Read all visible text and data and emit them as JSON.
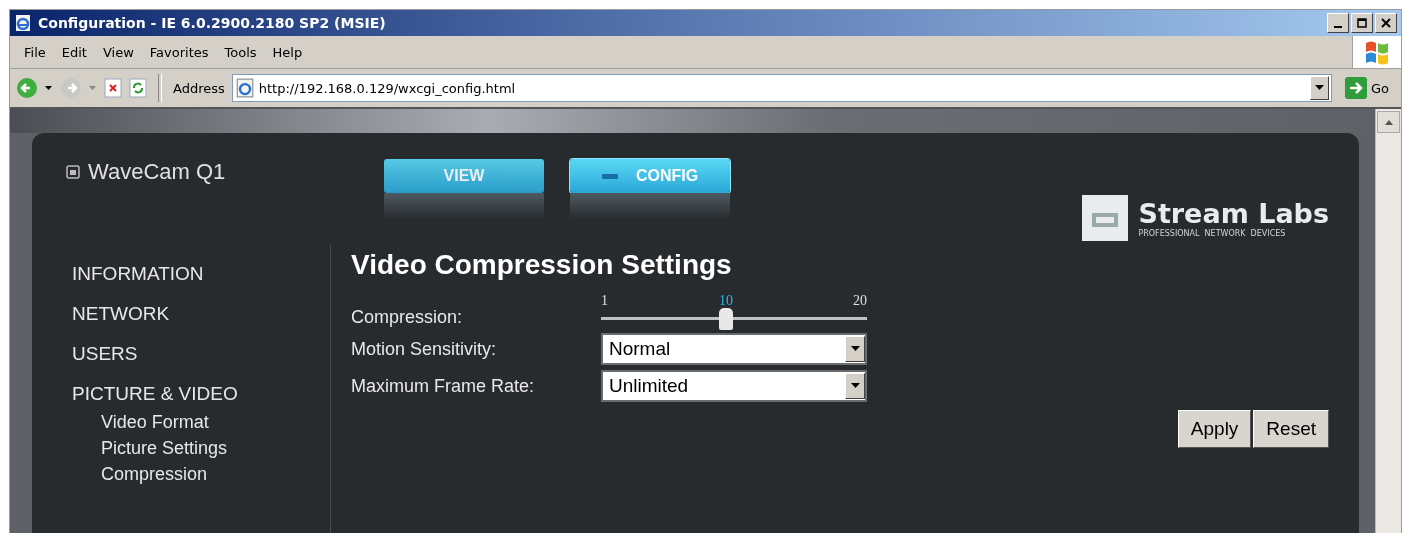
{
  "window": {
    "title": "Configuration - IE 6.0.2900.2180 SP2 (MSIE)"
  },
  "menu": [
    "File",
    "Edit",
    "View",
    "Favorites",
    "Tools",
    "Help"
  ],
  "address": {
    "label": "Address",
    "value": "http://192.168.0.129/wxcgi_config.html",
    "go": "Go"
  },
  "device": {
    "name": "WaveCam Q1"
  },
  "tabs": [
    {
      "label": "VIEW",
      "selected": false
    },
    {
      "label": "CONFIG",
      "selected": true
    }
  ],
  "logo": {
    "name": "Stream Labs",
    "tagline": "PROFESSIONAL  NETWORK  DEVICES"
  },
  "sidebar": {
    "items": [
      {
        "label": "INFORMATION"
      },
      {
        "label": "NETWORK"
      },
      {
        "label": "USERS"
      },
      {
        "label": "PICTURE & VIDEO",
        "children": [
          {
            "label": "Video Format"
          },
          {
            "label": "Picture Settings"
          },
          {
            "label": "Compression"
          }
        ]
      }
    ]
  },
  "heading": "Video Compression Settings",
  "compression": {
    "label": "Compression:",
    "min": "1",
    "value": "10",
    "max": "20",
    "level": 0.47
  },
  "fields": [
    {
      "label": "Motion Sensitivity:",
      "value": "Normal"
    },
    {
      "label": "Maximum Frame Rate:",
      "value": "Unlimited"
    }
  ],
  "buttons": [
    "Apply",
    "Reset"
  ]
}
